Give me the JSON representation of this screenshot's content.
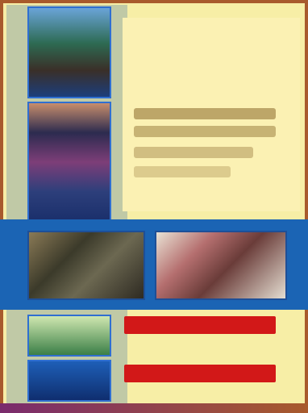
{
  "panel": {
    "title": "",
    "rows": [
      "",
      "",
      "",
      ""
    ]
  },
  "actions": {
    "primary_label": "",
    "secondary_label": ""
  },
  "colors": {
    "background": "#f7eea6",
    "accent_blue": "#1b64b4",
    "accent_red": "#d21818",
    "frame": "#a85a2c"
  }
}
